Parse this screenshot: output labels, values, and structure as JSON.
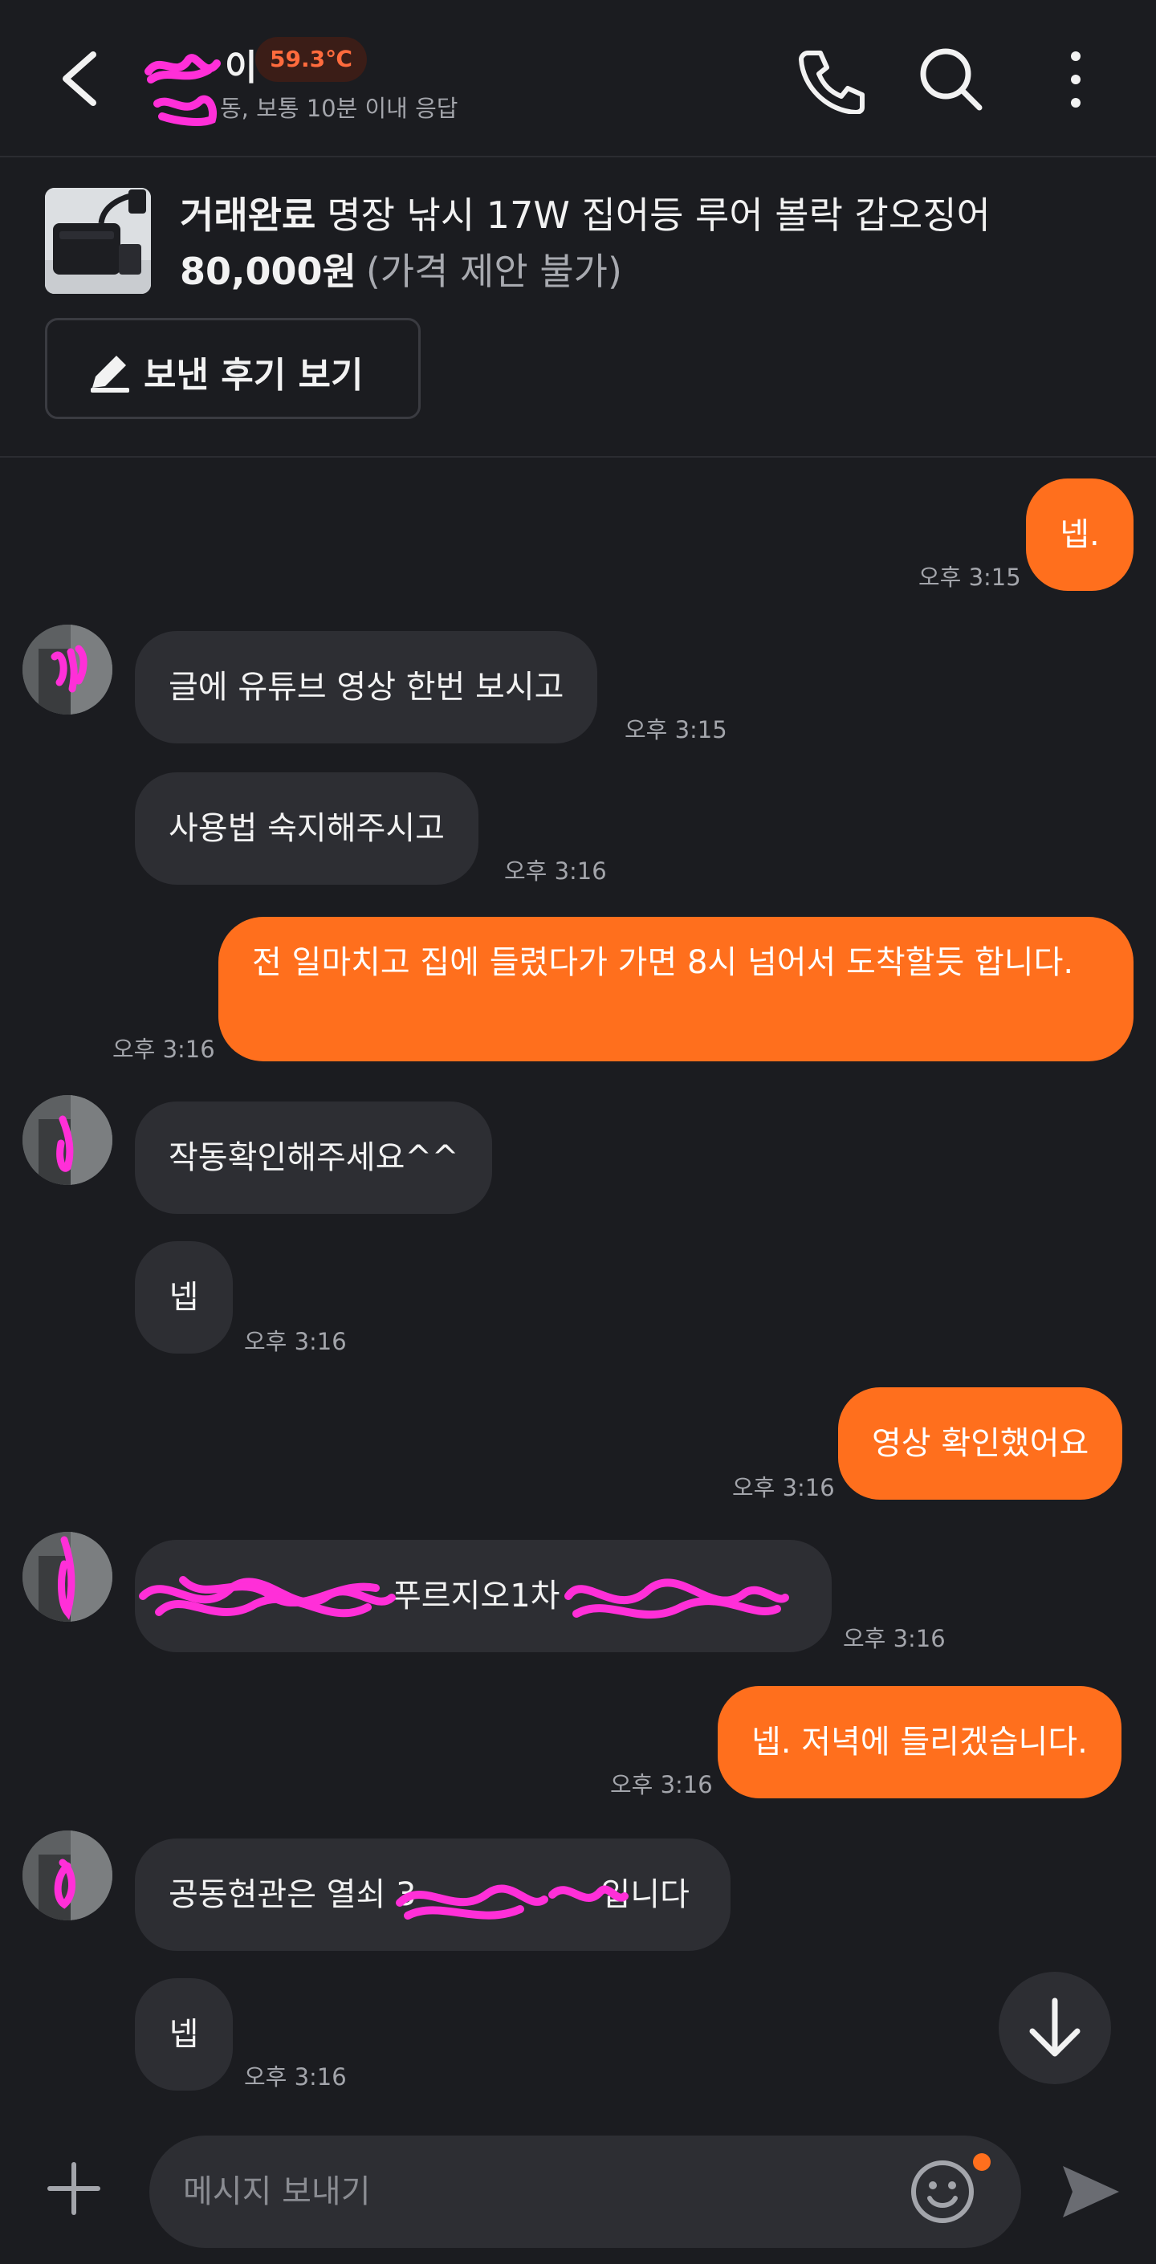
{
  "header": {
    "name": "이",
    "temperature": "59.3℃",
    "subtitle": "동, 보통 10분 이내 응답"
  },
  "product": {
    "status": "거래완료",
    "title": "명장 낚시 17W 집어등 루어 볼락 갑오징어",
    "price": "80,000원",
    "price_note": "(가격 제안 불가)",
    "review_button": "보낸 후기 보기"
  },
  "messages": [
    {
      "side": "out",
      "text": "넵.",
      "time": "오후 3:15"
    },
    {
      "side": "in",
      "text": "글에 유튜브 영상 한번 보시고",
      "time": "오후 3:15"
    },
    {
      "side": "in",
      "text": "사용법 숙지해주시고",
      "time": "오후 3:16"
    },
    {
      "side": "out",
      "text": "전 일마치고 집에 들렸다가 가면 8시 넘어서 도착할듯 합니다.",
      "time": "오후 3:16"
    },
    {
      "side": "in",
      "text": "작동확인해주세요^^",
      "time": ""
    },
    {
      "side": "in",
      "text": "넵",
      "time": "오후 3:16"
    },
    {
      "side": "out",
      "text": "영상 확인했어요",
      "time": "오후 3:16"
    },
    {
      "side": "in",
      "text": "푸르지오1차",
      "time": "오후 3:16"
    },
    {
      "side": "out",
      "text": "넵. 저녁에 들리겠습니다.",
      "time": "오후 3:16"
    },
    {
      "side": "in",
      "text": "공동현관은 열쇠 3",
      "text2": "입니다",
      "time": ""
    },
    {
      "side": "in",
      "text": "넵",
      "time": "오후 3:16"
    }
  ],
  "composer": {
    "placeholder": "메시지 보내기"
  },
  "colors": {
    "background": "#1b1c20",
    "incoming_bubble": "#2d2e33",
    "outgoing_bubble": "#ff6f1d",
    "temperature": "#ff6b3d",
    "scribble": "#ff2fd8"
  },
  "icons": [
    "back-arrow-icon",
    "phone-icon",
    "search-icon",
    "more-vertical-icon",
    "pencil-icon",
    "arrow-down-icon",
    "plus-icon",
    "smile-icon",
    "send-icon"
  ]
}
